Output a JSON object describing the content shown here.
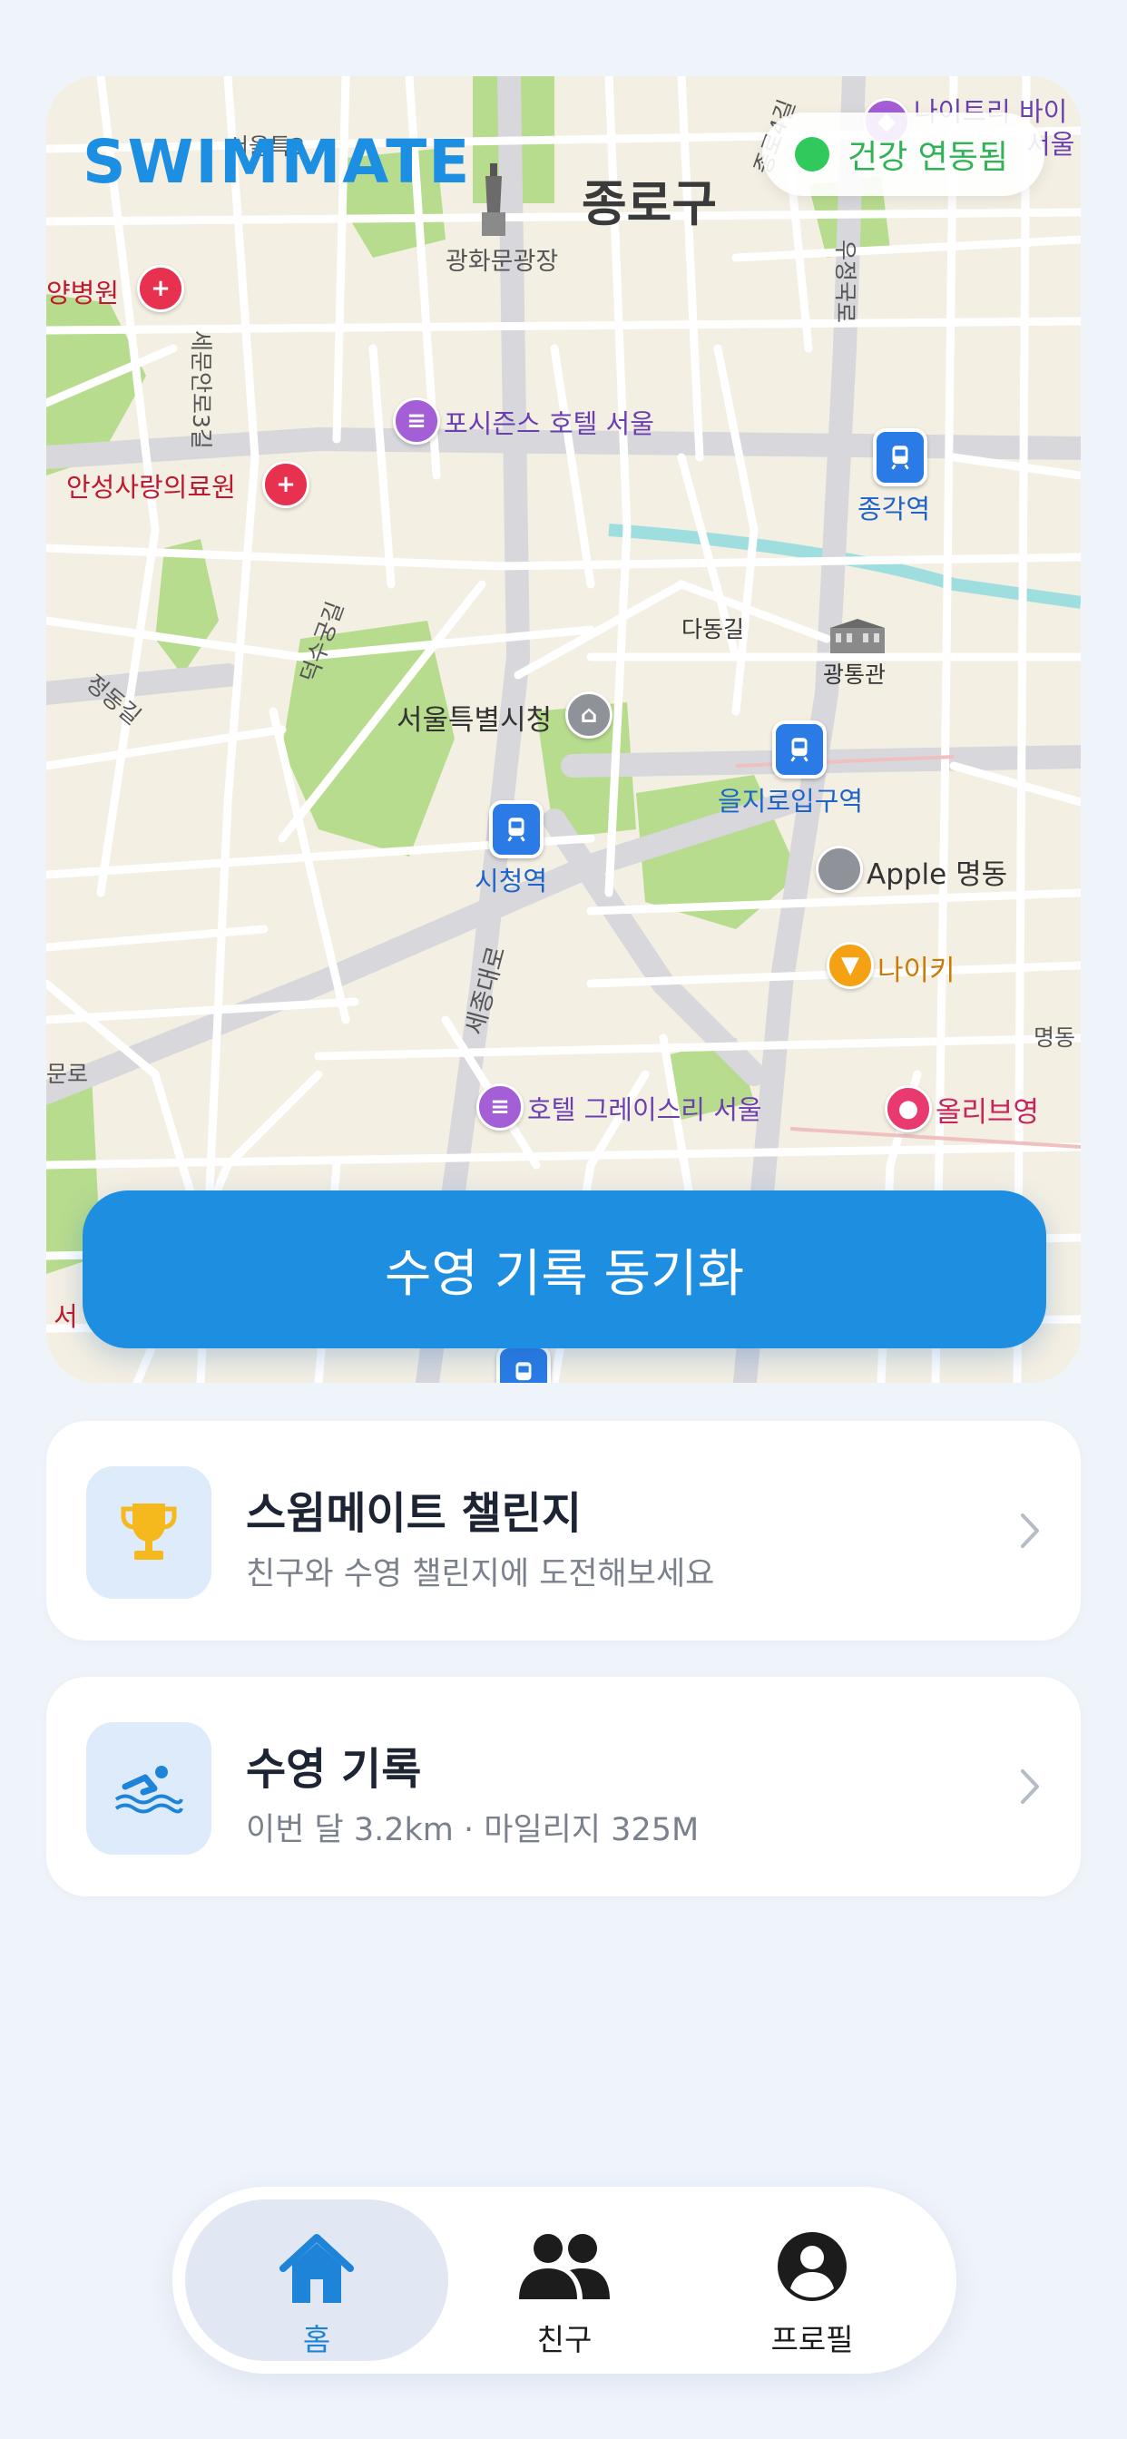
{
  "brand": "SWIMMATE",
  "health_status": "건강 연동됨",
  "sync_button": "수영 기록 동기화",
  "map": {
    "district": "종로구",
    "labels": {
      "gwanghwamun": "광화문광장",
      "sejongno": "세문안로3길",
      "hospital1": "양병원",
      "hospital2": "안성사랑의료원",
      "fourseasons": "포시즌스 호텔 서울",
      "jonggak": "종각역",
      "udjeongukro": "우정국로",
      "dadonggil": "다동길",
      "gwangtonggwan": "광통관",
      "cityhall": "서울특별시청",
      "euljiro": "을지로입구역",
      "sicheong": "시청역",
      "apple": "Apple 명동",
      "nike": "나이키",
      "sejongdaero": "세종대로",
      "gracery": "호텔 그레이스리 서울",
      "oliveyoung": "올리브영",
      "deoksugung": "덕수궁길",
      "jeongdong": "정동길",
      "myeongdong": "명동",
      "munro": "문로",
      "nightlife": "나이트리 바이",
      "seoul_suffix": "서울",
      "jongro4": "종로4길",
      "seo_top": "서울특3",
      "seo_bottom": "서"
    },
    "colors": {
      "land": "#f4efe3",
      "park": "#b7dc8e",
      "road": "#ffffff",
      "major_road": "#d7d7dc",
      "water": "#9fdede"
    }
  },
  "cards": [
    {
      "title": "스윔메이트 챌린지",
      "subtitle": "친구와 수영 챌린지에 도전해보세요",
      "icon": "trophy-icon"
    },
    {
      "title": "수영 기록",
      "subtitle": "이번 달 3.2km · 마일리지 325M",
      "icon": "swimmer-icon"
    }
  ],
  "tabs": [
    {
      "label": "홈",
      "icon": "home-icon",
      "active": true
    },
    {
      "label": "친구",
      "icon": "friends-icon",
      "active": false
    },
    {
      "label": "프로필",
      "icon": "profile-icon",
      "active": false
    }
  ],
  "accent": "#1e8fe0"
}
